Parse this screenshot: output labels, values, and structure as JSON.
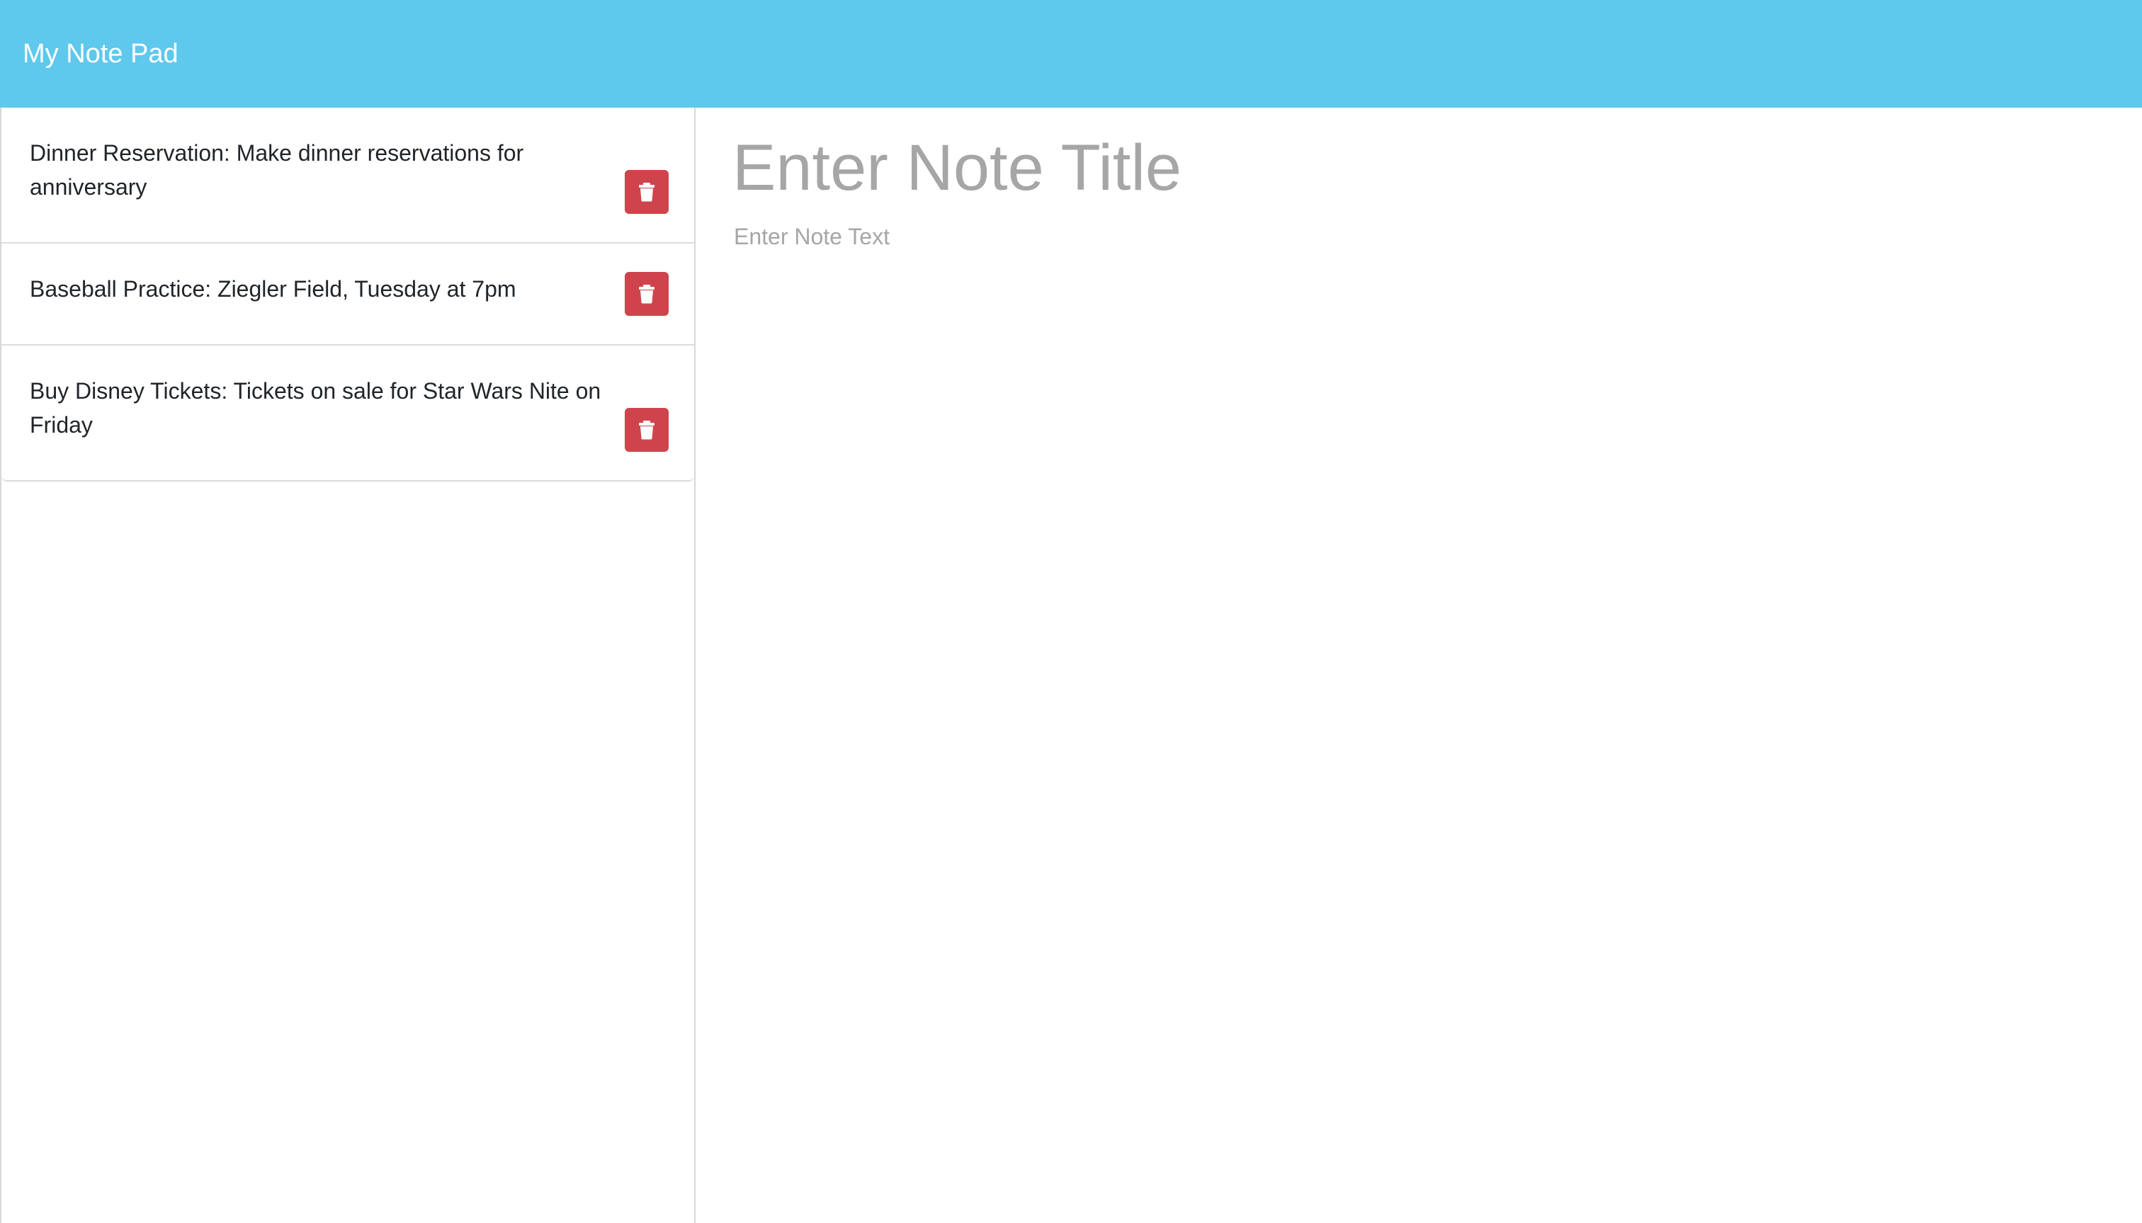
{
  "navbar": {
    "brand": "My Note Pad",
    "background_color": "#5fc8ed"
  },
  "sidebar": {
    "notes": [
      {
        "text": "Dinner Reservation: Make dinner reservations for anniversary",
        "delete_icon": "trash-icon"
      },
      {
        "text": "Baseball Practice: Ziegler Field, Tuesday at 7pm",
        "delete_icon": "trash-icon"
      },
      {
        "text": "Buy Disney Tickets: Tickets on sale for Star Wars Nite on Friday",
        "delete_icon": "trash-icon"
      }
    ],
    "delete_button_color": "#cf444c"
  },
  "editor": {
    "title_placeholder": "Enter Note Title",
    "text_placeholder": "Enter Note Text",
    "title_value": "",
    "text_value": ""
  }
}
